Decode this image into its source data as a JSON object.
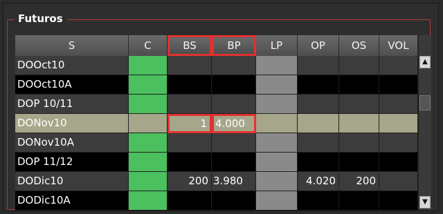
{
  "panel": {
    "title": "Futuros"
  },
  "columns": [
    "S",
    "C",
    "BS",
    "BP",
    "LP",
    "OP",
    "OS",
    "VOL"
  ],
  "highlighted_columns": [
    "BS",
    "BP"
  ],
  "rows": [
    {
      "s": "DOOct10",
      "c": "",
      "bs": "",
      "bp": "",
      "lp": "",
      "op": "",
      "os": "",
      "vol": "",
      "c_green": true
    },
    {
      "s": "DOOct10A",
      "c": "",
      "bs": "",
      "bp": "",
      "lp": "",
      "op": "",
      "os": "",
      "vol": "",
      "c_green": true
    },
    {
      "s": "DOP 10/11",
      "c": "",
      "bs": "",
      "bp": "",
      "lp": "",
      "op": "",
      "os": "",
      "vol": "",
      "c_green": true
    },
    {
      "s": "DONov10",
      "c": "",
      "bs": "1",
      "bp": "4.000",
      "lp": "",
      "op": "",
      "os": "",
      "vol": "",
      "c_green": false,
      "selected": true
    },
    {
      "s": "DONov10A",
      "c": "",
      "bs": "",
      "bp": "",
      "lp": "",
      "op": "",
      "os": "",
      "vol": "",
      "c_green": true
    },
    {
      "s": "DOP 11/12",
      "c": "",
      "bs": "",
      "bp": "",
      "lp": "",
      "op": "",
      "os": "",
      "vol": "",
      "c_green": true
    },
    {
      "s": "DODic10",
      "c": "",
      "bs": "200",
      "bp": "3.980",
      "lp": "",
      "op": "4.020",
      "os": "200",
      "vol": "",
      "c_green": true
    },
    {
      "s": "DODic10A",
      "c": "",
      "bs": "",
      "bp": "",
      "lp": "",
      "op": "",
      "os": "",
      "vol": "",
      "c_green": true
    }
  ],
  "colors": {
    "green": "#4cbf5e",
    "lp_gray": "#8a8a8a",
    "selected_row": "#a6a68a",
    "row_dark": "#000000",
    "row_gray": "#3c3c3c",
    "highlight_red": "#e23131"
  },
  "scrollbar": {
    "up_icon": "arrow-up-icon",
    "down_icon": "arrow-down-icon"
  }
}
